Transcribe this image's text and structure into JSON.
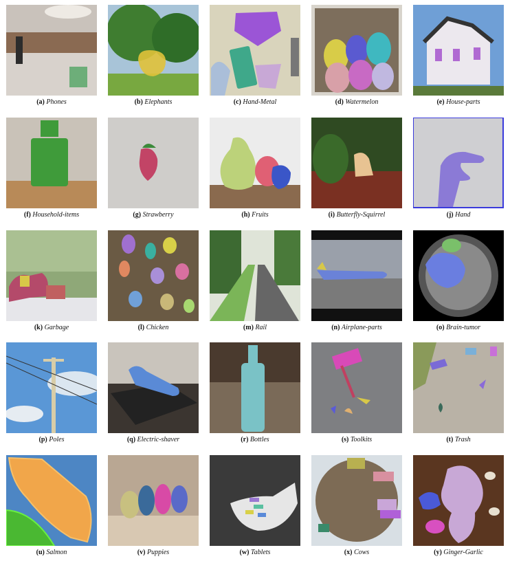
{
  "figure": {
    "items": [
      {
        "letter": "(a)",
        "name": "Phones",
        "bg": "#8a6a52",
        "accent": "#5aa86a",
        "icon": "phones-store"
      },
      {
        "letter": "(b)",
        "name": "Elephants",
        "bg": "#3e7a33",
        "accent": "#e0c23a",
        "icon": "trees"
      },
      {
        "letter": "(c)",
        "name": "Hand-Metal",
        "bg": "#d9d4bc",
        "accent": "#9b55d6",
        "icon": "metal-parts"
      },
      {
        "letter": "(d)",
        "name": "Watermelon",
        "bg": "#7d6e5c",
        "accent": "#c86ac4",
        "icon": "watermelon-crate"
      },
      {
        "letter": "(e)",
        "name": "House-parts",
        "bg": "#6f9fd6",
        "accent": "#b06ad2",
        "icon": "house"
      },
      {
        "letter": "(f)",
        "name": "Household-items",
        "bg": "#c9c2b8",
        "accent": "#3f9b3a",
        "icon": "bottle"
      },
      {
        "letter": "(g)",
        "name": "Strawberry",
        "bg": "#cfcdca",
        "accent": "#c24466",
        "icon": "strawberry"
      },
      {
        "letter": "(h)",
        "name": "Fruits",
        "bg": "#8a6a4e",
        "accent": "#bcd27a",
        "icon": "fruits"
      },
      {
        "letter": "(i)",
        "name": "Butterfly-Squirrel",
        "bg": "#2f4a22",
        "accent": "#e8c392",
        "icon": "squirrel"
      },
      {
        "letter": "(j)",
        "name": "Hand",
        "bg": "#cfcfd2",
        "accent": "#8b7ad6",
        "icon": "hand"
      },
      {
        "letter": "(k)",
        "name": "Garbage",
        "bg": "#6e8c4c",
        "accent": "#b44a6a",
        "icon": "garbage"
      },
      {
        "letter": "(l)",
        "name": "Chicken",
        "bg": "#6a5a44",
        "accent": "#a98fd8",
        "icon": "chicken"
      },
      {
        "letter": "(m)",
        "name": "Rail",
        "bg": "#5f8c4c",
        "accent": "#7bb558",
        "icon": "rail"
      },
      {
        "letter": "(n)",
        "name": "Airplane-parts",
        "bg": "#7b8089",
        "accent": "#6a82d8",
        "icon": "airplane"
      },
      {
        "letter": "(o)",
        "name": "Brain-tumor",
        "bg": "#111111",
        "accent": "#6a7ee0",
        "icon": "brain"
      },
      {
        "letter": "(p)",
        "name": "Poles",
        "bg": "#5a97d6",
        "accent": "#d8cda8",
        "icon": "poles"
      },
      {
        "letter": "(q)",
        "name": "Electric-shaver",
        "bg": "#3b3530",
        "accent": "#5a8ad6",
        "icon": "shaver"
      },
      {
        "letter": "(r)",
        "name": "Bottles",
        "bg": "#7a6a58",
        "accent": "#7ac2c6",
        "icon": "bottles"
      },
      {
        "letter": "(s)",
        "name": "Toolkits",
        "bg": "#7e7f82",
        "accent": "#d84ab8",
        "icon": "toolkits"
      },
      {
        "letter": "(t)",
        "name": "Trash",
        "bg": "#b9b2a6",
        "accent": "#7a6ad6",
        "icon": "trash"
      },
      {
        "letter": "(u)",
        "name": "Salmon",
        "bg": "#4d86c4",
        "accent": "#f1a64a",
        "icon": "salmon"
      },
      {
        "letter": "(v)",
        "name": "Puppies",
        "bg": "#b9a793",
        "accent": "#d84aa6",
        "icon": "puppies"
      },
      {
        "letter": "(w)",
        "name": "Tablets",
        "bg": "#2a2a2a",
        "accent": "#9a78d2",
        "icon": "tablets"
      },
      {
        "letter": "(x)",
        "name": "Cows",
        "bg": "#7d6b55",
        "accent": "#c9a6d8",
        "icon": "cows"
      },
      {
        "letter": "(y)",
        "name": "Ginger-Garlic",
        "bg": "#5a3620",
        "accent": "#c8a8d6",
        "icon": "ginger"
      }
    ]
  }
}
